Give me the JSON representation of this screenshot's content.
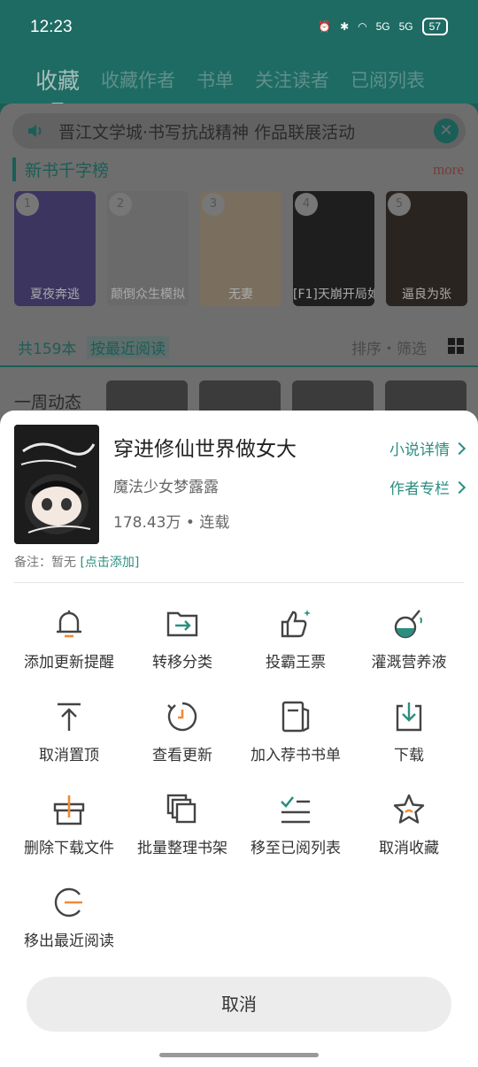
{
  "status": {
    "time": "12:23",
    "battery": "57",
    "signal1": "5G",
    "signal2": "5G"
  },
  "topnav": [
    "收藏",
    "收藏作者",
    "书单",
    "关注读者",
    "已阅列表"
  ],
  "notice": "晋江文学城·书写抗战精神 作品联展活动",
  "ranking": {
    "title": "新书千字榜",
    "more": "more",
    "books": [
      {
        "name": "夏夜奔逃",
        "rank": "1"
      },
      {
        "name": "颠倒众生模拟",
        "rank": "2"
      },
      {
        "name": "无妻",
        "rank": "3"
      },
      {
        "name": "[F1]天崩开局如",
        "rank": "4"
      },
      {
        "name": "逼良为张",
        "rank": "5"
      }
    ]
  },
  "shelf": {
    "count": "共159本",
    "sort": "按最近阅读",
    "filter": "排序・筛选",
    "weekly": "一周动态"
  },
  "sheet": {
    "title": "穿进修仙世界做女大",
    "author": "魔法少女梦露露",
    "meta": "178.43万 • 连载",
    "link_detail": "小说详情",
    "link_author": "作者专栏",
    "note_label": "备注：暂无",
    "note_add": "[点击添加]",
    "actions": [
      {
        "label": "添加更新提醒",
        "icon": "bell-icon"
      },
      {
        "label": "转移分类",
        "icon": "folder-move-icon"
      },
      {
        "label": "投霸王票",
        "icon": "thumbs-up-icon"
      },
      {
        "label": "灌溉营养液",
        "icon": "watering-flask-icon"
      },
      {
        "label": "取消置顶",
        "icon": "unpin-top-icon"
      },
      {
        "label": "查看更新",
        "icon": "refresh-clock-icon"
      },
      {
        "label": "加入荐书书单",
        "icon": "booklist-add-icon"
      },
      {
        "label": "下载",
        "icon": "download-icon"
      },
      {
        "label": "删除下载文件",
        "icon": "delete-download-icon"
      },
      {
        "label": "批量整理书架",
        "icon": "batch-organize-icon"
      },
      {
        "label": "移至已阅列表",
        "icon": "move-to-read-list-icon"
      },
      {
        "label": "取消收藏",
        "icon": "star-remove-icon"
      },
      {
        "label": "移出最近阅读",
        "icon": "remove-recent-icon"
      }
    ],
    "cancel": "取消"
  },
  "colors": {
    "accent": "#2b8f80",
    "accent_dark": "#1b5e57",
    "orange": "#f08a36"
  }
}
